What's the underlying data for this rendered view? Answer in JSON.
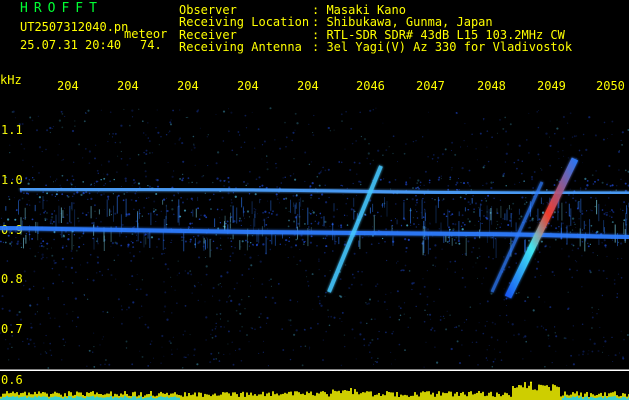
{
  "header": {
    "title": "HROFFT",
    "file": "UT2507312040.pn",
    "meteor_label": "meteor",
    "date": "25.07.31 20:40",
    "count": "74."
  },
  "info": [
    {
      "label": "Observer",
      "value": ": Masaki Kano"
    },
    {
      "label": "Receiving Location",
      "value": ": Shibukawa, Gunma, Japan"
    },
    {
      "label": "Receiver",
      "value": ": RTL-SDR SDR# 43dB L15 103.2MHz CW"
    },
    {
      "label": "Receiving Antenna",
      "value": ": 3el Yagi(V) Az 330 for Vladivostok"
    }
  ],
  "axis": {
    "unit": "kHz",
    "top_ticks": [
      "204",
      "204",
      "204",
      "204",
      "204",
      "2046",
      "2047",
      "2048",
      "2049",
      "2050"
    ],
    "y_ticks": [
      "1.1",
      "1.0",
      "0.9",
      "0.8",
      "0.7",
      "0.6"
    ]
  },
  "colors": {
    "background": "#000000",
    "title": "#00ff33",
    "text": "#ffff00",
    "signal_blue": "#2f7dff",
    "signal_cyan": "#41f3ff",
    "signal_red": "#ff3e2d",
    "bar_yellow": "#ffff00"
  }
}
